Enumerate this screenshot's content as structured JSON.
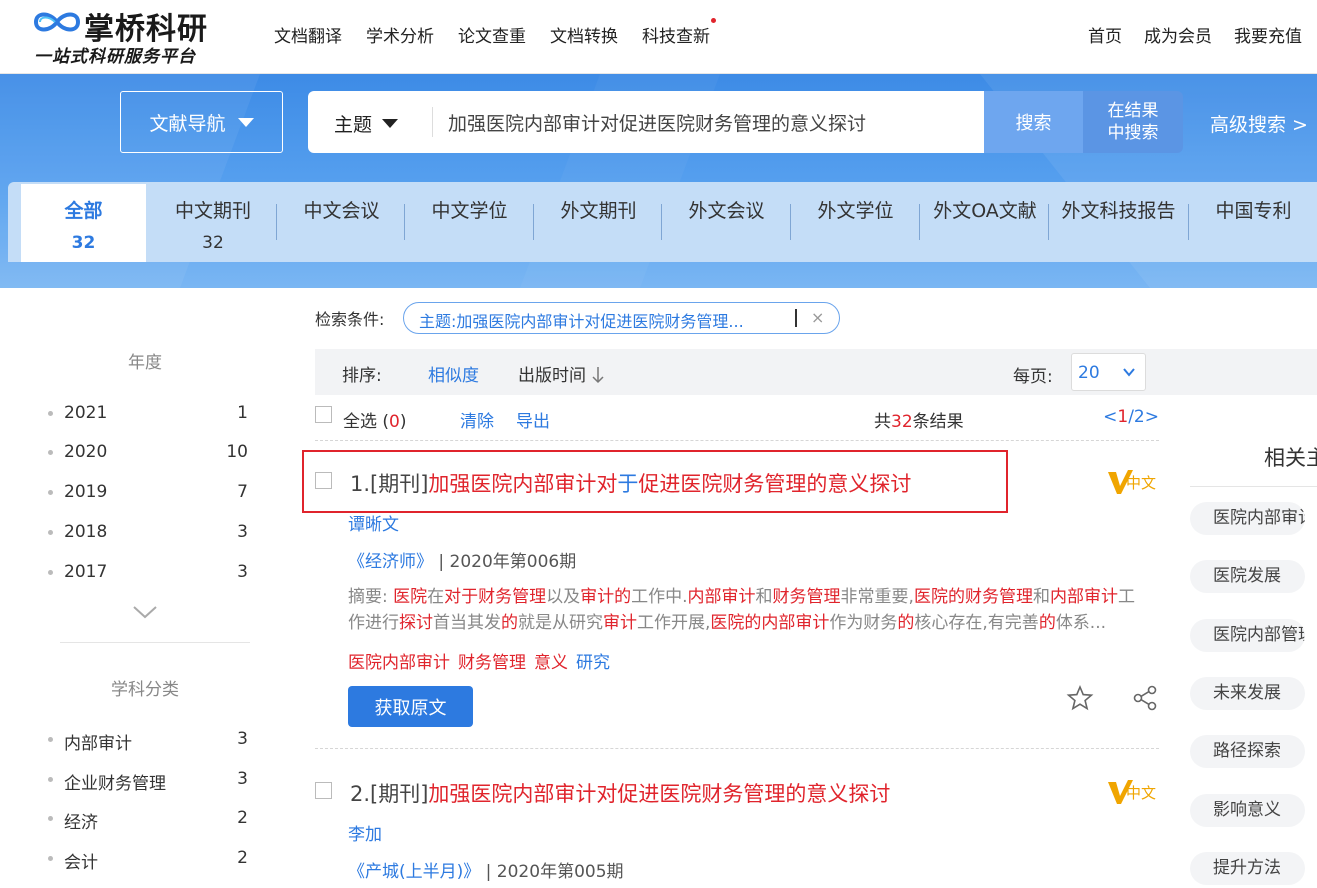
{
  "brand": {
    "name": "掌桥科研",
    "slogan": "一站式科研服务平台"
  },
  "topnav": [
    "文档翻译",
    "学术分析",
    "论文查重",
    "文档转换",
    "科技查新"
  ],
  "rightnav": [
    "首页",
    "成为会员",
    "我要充值"
  ],
  "search": {
    "nav_button": "文献导航",
    "field": "主题",
    "query": "加强医院内部审计对促进医院财务管理的意义探讨",
    "search_button": "搜索",
    "within_line1": "在结果",
    "within_line2": "中搜索",
    "advanced": "高级搜索 >"
  },
  "tabs": [
    {
      "label": "全部",
      "count": "32"
    },
    {
      "label": "中文期刊",
      "count": "32"
    },
    {
      "label": "中文会议",
      "count": ""
    },
    {
      "label": "中文学位",
      "count": ""
    },
    {
      "label": "外文期刊",
      "count": ""
    },
    {
      "label": "外文会议",
      "count": ""
    },
    {
      "label": "外文学位",
      "count": ""
    },
    {
      "label": "外文OA文献",
      "count": ""
    },
    {
      "label": "外文科技报告",
      "count": ""
    },
    {
      "label": "中国专利",
      "count": ""
    }
  ],
  "sidebar": {
    "year_title": "年度",
    "years": [
      {
        "label": "2021",
        "count": "1"
      },
      {
        "label": "2020",
        "count": "10"
      },
      {
        "label": "2019",
        "count": "7"
      },
      {
        "label": "2018",
        "count": "3"
      },
      {
        "label": "2017",
        "count": "3"
      }
    ],
    "subject_title": "学科分类",
    "subjects": [
      {
        "label": "内部审计",
        "count": "3"
      },
      {
        "label": "企业财务管理",
        "count": "3"
      },
      {
        "label": "经济",
        "count": "2"
      },
      {
        "label": "会计",
        "count": "2"
      }
    ]
  },
  "conditions": {
    "label": "检索条件:",
    "tag": "主题:加强医院内部审计对促进医院财务管理...",
    "close": "×"
  },
  "sort": {
    "label": "排序:",
    "similarity": "相似度",
    "date": "出版时间",
    "per_page_label": "每页:",
    "per_page_value": "20"
  },
  "toolbar": {
    "select_all": "全选",
    "selected_count": "0",
    "clear": "清除",
    "export": "导出",
    "total_prefix": "共",
    "total": "32",
    "total_suffix": "条结果",
    "page_current": "1",
    "page_total": "2"
  },
  "results": [
    {
      "index_type": "1.[期刊]",
      "title_a": "加强医院内部审计对",
      "title_b": "于",
      "title_c": "促进医院财务管理的意义探讨",
      "badge": "中文",
      "author": "谭晰文",
      "journal": "《经济师》",
      "issue": "| 2020年第006期",
      "abstract_label": "摘要:",
      "abstract": [
        {
          "t": "医院",
          "h": true
        },
        {
          "t": "在",
          "h": false
        },
        {
          "t": "对于",
          "h": true
        },
        {
          "t": "财务管理",
          "h": true
        },
        {
          "t": "以及",
          "h": false
        },
        {
          "t": "审计的",
          "h": true
        },
        {
          "t": "工作中.",
          "h": false
        },
        {
          "t": "内部审计",
          "h": true
        },
        {
          "t": "和",
          "h": false
        },
        {
          "t": "财务管理",
          "h": true
        },
        {
          "t": "非常重要,",
          "h": false
        },
        {
          "t": "医院的财务管理",
          "h": true
        },
        {
          "t": "和",
          "h": false
        },
        {
          "t": "内部审计",
          "h": true
        },
        {
          "t": "工作进行",
          "h": false
        },
        {
          "t": "探讨",
          "h": true
        },
        {
          "t": "首当其发",
          "h": false
        },
        {
          "t": "的",
          "h": true
        },
        {
          "t": "就是从研究",
          "h": false
        },
        {
          "t": "审计",
          "h": true
        },
        {
          "t": "工作开展,",
          "h": false
        },
        {
          "t": "医院的内部审计",
          "h": true
        },
        {
          "t": "作为财务",
          "h": false
        },
        {
          "t": "的",
          "h": true
        },
        {
          "t": "核心存在,有完善",
          "h": false
        },
        {
          "t": "的",
          "h": true
        },
        {
          "t": "体系...",
          "h": false
        }
      ],
      "keywords": [
        {
          "t": "医院内部审计",
          "h": true
        },
        {
          "t": "财务管理",
          "h": true
        },
        {
          "t": "意义",
          "h": true
        },
        {
          "t": "研究",
          "h": false
        }
      ],
      "get_button": "获取原文"
    },
    {
      "index_type": "2.[期刊]",
      "title_a": "加强医院内部审计对促进医院财务管理的意义探讨",
      "badge": "中文",
      "author": "李加",
      "journal": "《产城(上半月)》",
      "issue": "| 2020年第005期"
    }
  ],
  "related": {
    "title": "相关主",
    "tags": [
      "医院内部审计",
      "医院发展",
      "医院内部管理",
      "未来发展",
      "路径探索",
      "影响意义",
      "提升方法"
    ]
  },
  "colors": {
    "accent": "#2d7ae0",
    "highlight": "#e0242c",
    "band": "#4a94eb"
  }
}
